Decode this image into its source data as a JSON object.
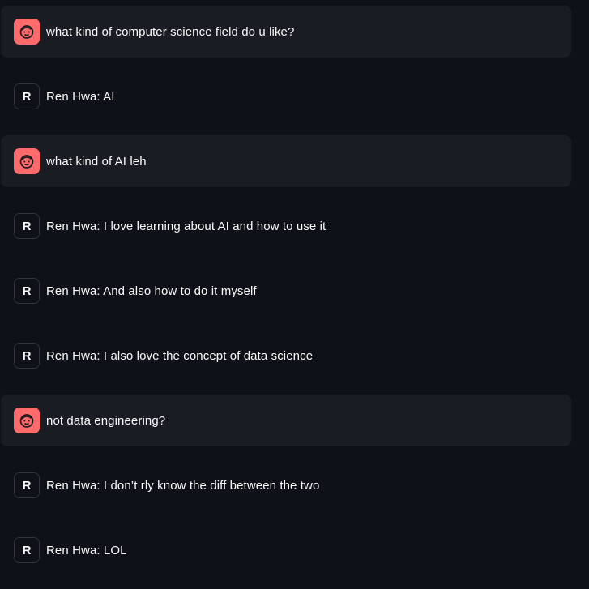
{
  "colors": {
    "background": "#0e1117",
    "user_bubble": "#1a1c24",
    "user_avatar": "#ff6b6b",
    "assistant_avatar_border": "#31333f",
    "text": "#fafafa"
  },
  "messages": [
    {
      "role": "user",
      "avatar_icon": "smiley-face-icon",
      "text": "what kind of computer science field do u like?"
    },
    {
      "role": "assistant",
      "avatar_letter": "R",
      "text": "Ren Hwa: AI"
    },
    {
      "role": "user",
      "avatar_icon": "smiley-face-icon",
      "text": "what kind of AI leh"
    },
    {
      "role": "assistant",
      "avatar_letter": "R",
      "text": "Ren Hwa: I love learning about AI and how to use it"
    },
    {
      "role": "assistant",
      "avatar_letter": "R",
      "text": "Ren Hwa: And also how to do it myself"
    },
    {
      "role": "assistant",
      "avatar_letter": "R",
      "text": "Ren Hwa: I also love the concept of data science"
    },
    {
      "role": "user",
      "avatar_icon": "smiley-face-icon",
      "text": "not data engineering?"
    },
    {
      "role": "assistant",
      "avatar_letter": "R",
      "text": "Ren Hwa: I don’t rly know the diff between the two"
    },
    {
      "role": "assistant",
      "avatar_letter": "R",
      "text": "Ren Hwa: LOL"
    }
  ]
}
